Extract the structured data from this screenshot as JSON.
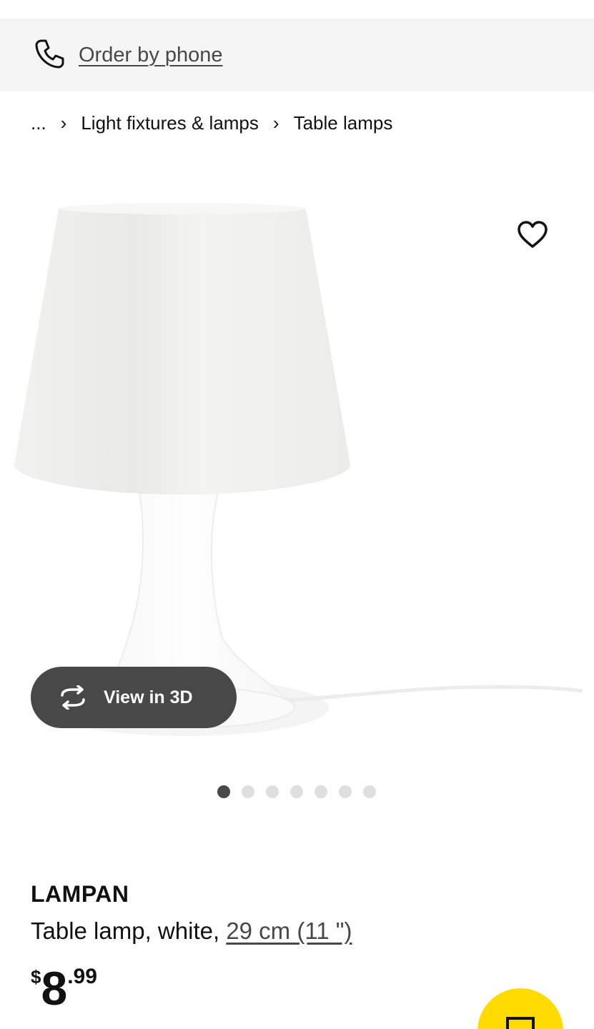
{
  "order_bar": {
    "icon": "phone-icon",
    "label": "Order by phone",
    "bg_color": "#f5f5f5"
  },
  "breadcrumb": {
    "ellipsis": "...",
    "separator": "›",
    "items": [
      "Light fixtures & lamps",
      "Table lamps"
    ]
  },
  "gallery": {
    "view_3d_label": "View in 3D",
    "view_3d_icon": "rotate-3d-icon",
    "favorite_icon": "heart-icon",
    "image_count": 7,
    "active_index": 0
  },
  "product": {
    "name": "LAMPAN",
    "description_prefix": "Table lamp, white, ",
    "size_link": "29 cm (11 \")",
    "price": {
      "currency": "$",
      "integer": "8",
      "decimal": ".99"
    }
  },
  "fab": {
    "icon": "chat-icon",
    "color": "#ffdb00"
  },
  "colors": {
    "text": "#111111",
    "muted": "#484848",
    "dot_inactive": "#dfdfdf"
  }
}
